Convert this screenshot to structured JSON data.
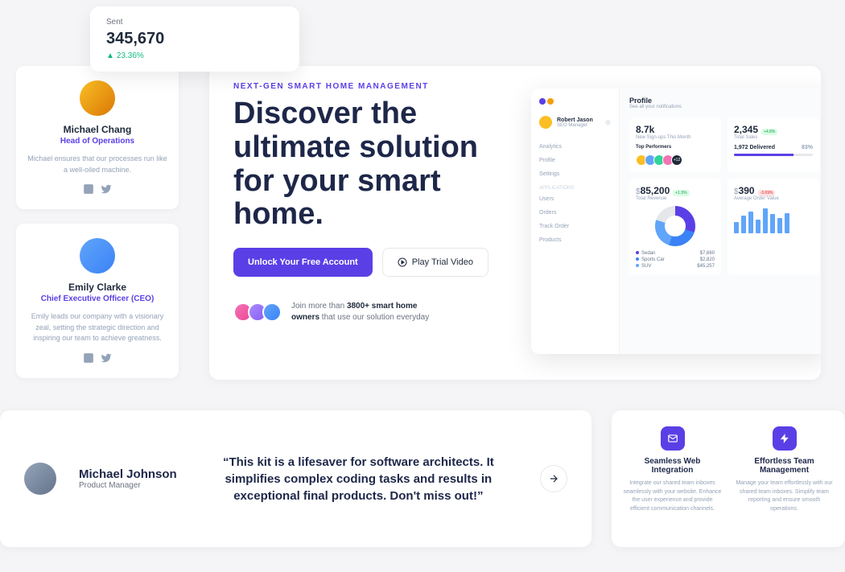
{
  "stat": {
    "label": "Sent",
    "value": "345,670",
    "change": "23.36%"
  },
  "team": [
    {
      "name": "Michael Chang",
      "role": "Head of Operations",
      "bio": "Michael ensures that our processes run like a well-oiled machine."
    },
    {
      "name": "Emily Clarke",
      "role": "Chief Executive Officer (CEO)",
      "bio": "Emily leads our company with a visionary zeal, setting the strategic direction and inspiring our team to achieve greatness."
    }
  ],
  "hero": {
    "eyebrow": "NEXT-GEN SMART HOME MANAGEMENT",
    "title": "Discover the ultimate solution for your smart home.",
    "primary": "Unlock Your Free Account",
    "secondary": "Play Trial Video",
    "join_pre": "Join more than ",
    "join_bold": "3800+ smart home owners",
    "join_post": " that use our solution everyday"
  },
  "dash": {
    "user": {
      "name": "Robert Jason",
      "role": "SEO Manager"
    },
    "nav": [
      "Analytics",
      "Profile",
      "Settings"
    ],
    "nav_label": "APPLICATIONS",
    "nav2": [
      "Users",
      "Orders",
      "Track Order",
      "Products"
    ],
    "header": {
      "title": "Profile",
      "sub": "See all your notifications"
    },
    "signups": {
      "value": "8.7k",
      "label": "New Sign-ups This Month"
    },
    "perf_label": "Top Performers",
    "perf_more": "+12",
    "sales": {
      "value": "2,345",
      "label": "Total Sales",
      "badge": "+4.8%"
    },
    "delivered": {
      "value": "1,972 Delivered",
      "pct": "83%"
    },
    "revenue": {
      "value": "85,200",
      "label": "Total Revenue",
      "badge": "+1.5%"
    },
    "legend": [
      {
        "name": "Sedan",
        "val": "$7,660"
      },
      {
        "name": "Sports Car",
        "val": "$2,820"
      },
      {
        "name": "SUV",
        "val": "$45,257"
      }
    ],
    "aov": {
      "value": "390",
      "label": "Average Order Value",
      "badge": "-3.69%"
    }
  },
  "testimonial": {
    "name": "Michael Johnson",
    "role": "Product Manager",
    "quote": "“This kit is a lifesaver for software architects. It simplifies complex coding tasks and results in exceptional final products. Don't miss out!”"
  },
  "features": [
    {
      "title": "Seamless Web Integration",
      "desc": "Integrate our shared team inboxes seamlessly with your website. Enhance the user experience and provide efficient communication channels."
    },
    {
      "title": "Effortless Team Management",
      "desc": "Manage your team effortlessly with our shared team inboxes. Simplify team reporting and ensure smooth operations."
    }
  ]
}
